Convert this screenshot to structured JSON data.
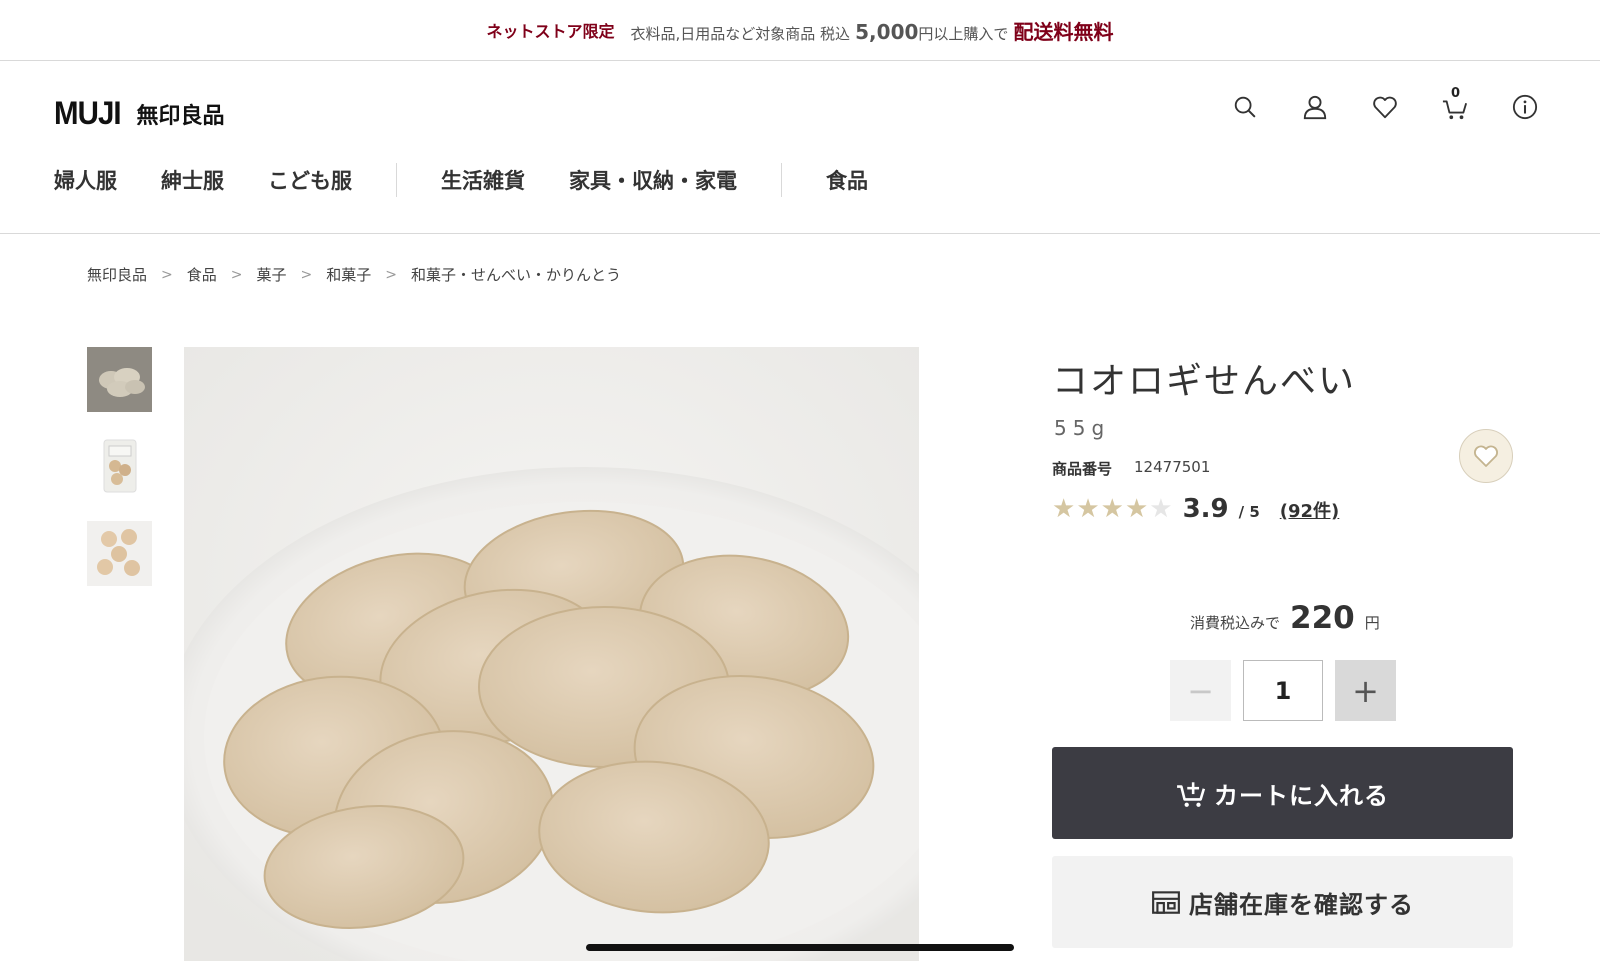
{
  "promo": {
    "label": "ネットストア限定",
    "body": "衣料品,日用品など対象商品 税込",
    "amount": "5,000",
    "suffix": "円以上購入で",
    "free": "配送料無料"
  },
  "header": {
    "logo_en": "MUJI",
    "logo_jp": "無印良品",
    "icons": [
      "search-icon",
      "account-icon",
      "heart-icon",
      "cart-icon",
      "info-icon"
    ],
    "cart_count": "0"
  },
  "nav": {
    "items": [
      "婦人服",
      "紳士服",
      "こども服",
      "生活雑貨",
      "家具・収納・家電",
      "食品"
    ]
  },
  "breadcrumb": [
    "無印良品",
    "食品",
    "菓子",
    "和菓子",
    "和菓子・せんべい・かりんとう"
  ],
  "product": {
    "title": "コオロギせんべい",
    "size": "55g",
    "code_label": "商品番号",
    "code": "12477501",
    "rating": {
      "value": "3.9",
      "max": "/ 5",
      "count": "(92件)",
      "stars_filled": 4,
      "stars_total": 5
    },
    "price": {
      "tax_label": "消費税込みで",
      "amount": "220",
      "unit": "円"
    },
    "quantity": "1",
    "quantity_minus": "−",
    "quantity_plus": "+",
    "cart_button": "カートに入れる",
    "store_button": "店舗在庫を確認する"
  },
  "colors": {
    "accent_red": "#7f0019",
    "dark_button": "#3c3c43",
    "star": "#d5c6a1"
  }
}
